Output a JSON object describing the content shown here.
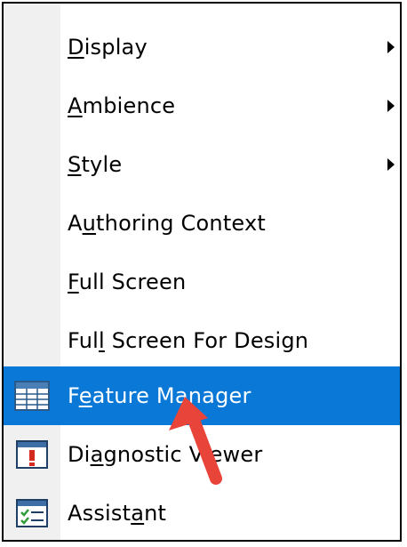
{
  "menu": {
    "items": [
      {
        "label": "Display",
        "mnemonic": 0,
        "has_submenu": true
      },
      {
        "label": "Ambience",
        "mnemonic": 0,
        "has_submenu": true
      },
      {
        "label": "Style",
        "mnemonic": 0,
        "has_submenu": true
      },
      {
        "label": "Authoring Context",
        "mnemonic": 1,
        "has_submenu": false
      },
      {
        "label": "Full Screen",
        "mnemonic": 0,
        "has_submenu": false
      },
      {
        "label": "Full Screen For Design",
        "mnemonic": 3,
        "has_submenu": false
      },
      {
        "label": "Feature Manager",
        "mnemonic": 1,
        "has_submenu": false,
        "highlighted": true,
        "icon": "feature-manager-grid-icon"
      },
      {
        "label": "Diagnostic Viewer",
        "mnemonic": 2,
        "has_submenu": false,
        "icon": "diagnostic-viewer-icon"
      },
      {
        "label": "Assistant",
        "mnemonic": 6,
        "has_submenu": false,
        "icon": "assistant-checklist-icon"
      }
    ]
  },
  "colors": {
    "highlight": "#0a78d7",
    "gutter": "#f0f0f0",
    "annotation_arrow": "#e8443a"
  }
}
